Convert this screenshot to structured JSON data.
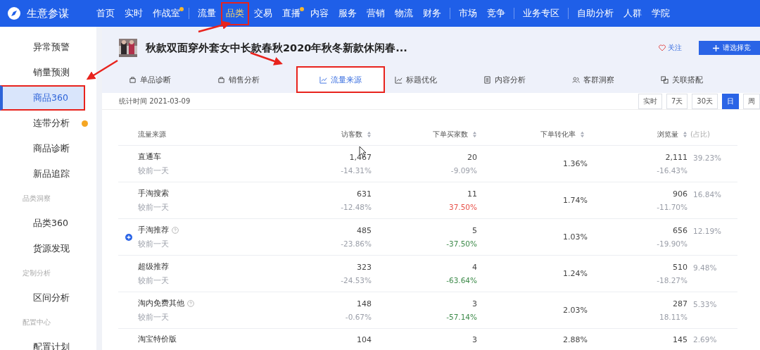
{
  "topnav": {
    "brand": "生意参谋",
    "groups": [
      [
        {
          "label": "首页",
          "selected": false,
          "dot": false,
          "highlighted": false
        },
        {
          "label": "实时",
          "selected": false,
          "dot": false,
          "highlighted": false
        },
        {
          "label": "作战室",
          "selected": false,
          "dot": true,
          "highlighted": false
        }
      ],
      [
        {
          "label": "流量",
          "selected": false,
          "dot": false,
          "highlighted": false
        },
        {
          "label": "品类",
          "selected": true,
          "dot": false,
          "highlighted": true
        },
        {
          "label": "交易",
          "selected": false,
          "dot": false,
          "highlighted": false
        },
        {
          "label": "直播",
          "selected": false,
          "dot": true,
          "highlighted": false
        },
        {
          "label": "内容",
          "selected": false,
          "dot": false,
          "highlighted": false
        },
        {
          "label": "服务",
          "selected": false,
          "dot": false,
          "highlighted": false
        },
        {
          "label": "营销",
          "selected": false,
          "dot": false,
          "highlighted": false
        },
        {
          "label": "物流",
          "selected": false,
          "dot": false,
          "highlighted": false
        },
        {
          "label": "财务",
          "selected": false,
          "dot": false,
          "highlighted": false
        }
      ],
      [
        {
          "label": "市场",
          "selected": false,
          "dot": false,
          "highlighted": false
        },
        {
          "label": "竞争",
          "selected": false,
          "dot": false,
          "highlighted": false
        }
      ],
      [
        {
          "label": "业务专区",
          "selected": false,
          "dot": false,
          "highlighted": false
        }
      ],
      [
        {
          "label": "自助分析",
          "selected": false,
          "dot": false,
          "highlighted": false
        },
        {
          "label": "人群",
          "selected": false,
          "dot": false,
          "highlighted": false
        },
        {
          "label": "学院",
          "selected": false,
          "dot": false,
          "highlighted": false
        }
      ]
    ]
  },
  "sidebar": {
    "items": [
      {
        "kind": "item",
        "label": "异常预警",
        "selected": false,
        "dot": false,
        "highlighted": false
      },
      {
        "kind": "item",
        "label": "销量预测",
        "selected": false,
        "dot": false,
        "highlighted": false
      },
      {
        "kind": "item",
        "label": "商品360",
        "selected": true,
        "dot": false,
        "highlighted": true
      },
      {
        "kind": "item",
        "label": "连带分析",
        "selected": false,
        "dot": true,
        "highlighted": false
      },
      {
        "kind": "item",
        "label": "商品诊断",
        "selected": false,
        "dot": false,
        "highlighted": false
      },
      {
        "kind": "item",
        "label": "新品追踪",
        "selected": false,
        "dot": false,
        "highlighted": false
      },
      {
        "kind": "group",
        "label": "品类洞察"
      },
      {
        "kind": "item",
        "label": "品类360",
        "selected": false,
        "dot": false,
        "highlighted": false
      },
      {
        "kind": "item",
        "label": "货源发现",
        "selected": false,
        "dot": false,
        "highlighted": false
      },
      {
        "kind": "group",
        "label": "定制分析"
      },
      {
        "kind": "item",
        "label": "区间分析",
        "selected": false,
        "dot": false,
        "highlighted": false
      },
      {
        "kind": "group",
        "label": "配置中心"
      },
      {
        "kind": "item",
        "label": "配置计划",
        "selected": false,
        "dot": false,
        "highlighted": false
      }
    ]
  },
  "product": {
    "title": "秋款双面穿外套女中长款春秋2020年秋冬新款休闲春...",
    "follow": "关注",
    "compare_button": "请选择竞"
  },
  "tabs": [
    {
      "label": "单品诊断",
      "selected": false,
      "highlighted": false
    },
    {
      "label": "销售分析",
      "selected": false,
      "highlighted": false
    },
    {
      "label": "流量来源",
      "selected": true,
      "highlighted": true
    },
    {
      "label": "标题优化",
      "selected": false,
      "highlighted": false
    },
    {
      "label": "内容分析",
      "selected": false,
      "highlighted": false
    },
    {
      "label": "客群洞察",
      "selected": false,
      "highlighted": false
    },
    {
      "label": "关联搭配",
      "selected": false,
      "highlighted": false
    }
  ],
  "stats": {
    "label": "统计时间 2021-03-09",
    "periods": [
      {
        "label": "实时",
        "selected": false
      },
      {
        "label": "7天",
        "selected": false
      },
      {
        "label": "30天",
        "selected": false
      },
      {
        "label": "日",
        "selected": true
      },
      {
        "label": "周",
        "selected": false
      }
    ]
  },
  "table": {
    "columns": [
      "流量来源",
      "访客数",
      "下单买家数",
      "下单转化率",
      "浏览量",
      "(占比)"
    ],
    "rows": [
      {
        "name": "直通车",
        "help": false,
        "expand": false,
        "compare": "较前一天",
        "visitors": "1,467",
        "visitors_change": "-14.31%",
        "buyers": "20",
        "buyers_change": {
          "text": "-9.09%",
          "color": "#9a9ea8"
        },
        "conversion": "1.36%",
        "views": "2,111",
        "views_change": "-16.43%",
        "share": "39.23%"
      },
      {
        "name": "手淘搜索",
        "help": false,
        "expand": false,
        "compare": "较前一天",
        "visitors": "631",
        "visitors_change": "-12.48%",
        "buyers": "11",
        "buyers_change": {
          "text": "37.50%",
          "color": "#e8524a"
        },
        "conversion": "1.74%",
        "views": "906",
        "views_change": "-11.70%",
        "share": "16.84%"
      },
      {
        "name": "手淘推荐",
        "help": true,
        "expand": true,
        "compare": "较前一天",
        "visitors": "485",
        "visitors_change": "-23.86%",
        "buyers": "5",
        "buyers_change": {
          "text": "-37.50%",
          "color": "#3d8a4a"
        },
        "conversion": "1.03%",
        "views": "656",
        "views_change": "-19.90%",
        "share": "12.19%"
      },
      {
        "name": "超级推荐",
        "help": false,
        "expand": false,
        "compare": "较前一天",
        "visitors": "323",
        "visitors_change": "-24.53%",
        "buyers": "4",
        "buyers_change": {
          "text": "-63.64%",
          "color": "#3d8a4a"
        },
        "conversion": "1.24%",
        "views": "510",
        "views_change": "-18.27%",
        "share": "9.48%"
      },
      {
        "name": "淘内免费其他",
        "help": true,
        "expand": false,
        "compare": "较前一天",
        "visitors": "148",
        "visitors_change": "-0.67%",
        "buyers": "3",
        "buyers_change": {
          "text": "-57.14%",
          "color": "#3d8a4a"
        },
        "conversion": "2.03%",
        "views": "287",
        "views_change": "18.11%",
        "share": "5.33%"
      },
      {
        "name": "淘宝特价版",
        "help": false,
        "expand": false,
        "visitors": "104",
        "buyers": "3",
        "conversion": "2.88%",
        "views": "145",
        "share": "2.69%"
      }
    ]
  }
}
